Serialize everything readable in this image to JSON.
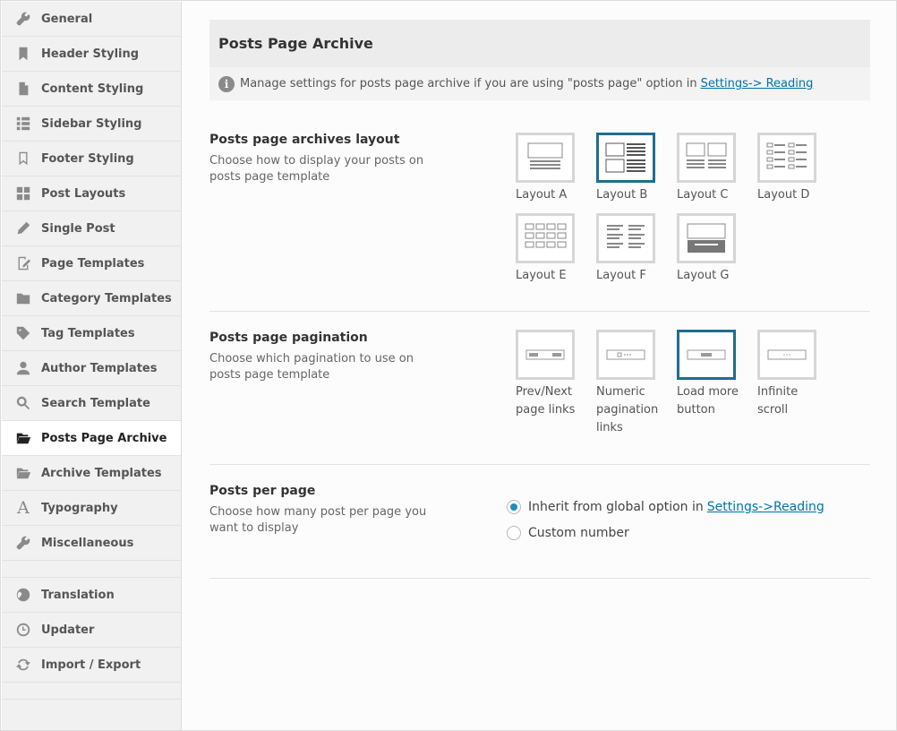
{
  "sidebar": {
    "items": [
      {
        "label": "General",
        "icon": "wrench-icon"
      },
      {
        "label": "Header Styling",
        "icon": "bookmark-icon"
      },
      {
        "label": "Content Styling",
        "icon": "document-icon"
      },
      {
        "label": "Sidebar Styling",
        "icon": "list-icon"
      },
      {
        "label": "Footer Styling",
        "icon": "bookmark-outline-icon"
      },
      {
        "label": "Post Layouts",
        "icon": "grid-icon"
      },
      {
        "label": "Single Post",
        "icon": "pencil-icon"
      },
      {
        "label": "Page Templates",
        "icon": "edit-page-icon"
      },
      {
        "label": "Category Templates",
        "icon": "folder-icon"
      },
      {
        "label": "Tag Templates",
        "icon": "tag-icon"
      },
      {
        "label": "Author Templates",
        "icon": "user-icon"
      },
      {
        "label": "Search Template",
        "icon": "search-icon"
      },
      {
        "label": "Posts Page Archive",
        "icon": "folder-open-icon",
        "active": true
      },
      {
        "label": "Archive Templates",
        "icon": "folder-open-icon"
      },
      {
        "label": "Typography",
        "icon": "typography-icon"
      },
      {
        "label": "Miscellaneous",
        "icon": "wrench-icon"
      }
    ],
    "bottom_items": [
      {
        "label": "Translation",
        "icon": "globe-icon"
      },
      {
        "label": "Updater",
        "icon": "clock-icon"
      },
      {
        "label": "Import / Export",
        "icon": "refresh-icon"
      }
    ]
  },
  "header": {
    "title": "Posts Page Archive",
    "notice_text": "Manage settings for posts page archive if you are using \"posts page\" option in",
    "notice_link": "Settings-> Reading"
  },
  "layout_section": {
    "title": "Posts page archives layout",
    "description": "Choose how to display your posts on posts page template",
    "options": [
      {
        "label": "Layout A"
      },
      {
        "label": "Layout B",
        "selected": true
      },
      {
        "label": "Layout C"
      },
      {
        "label": "Layout D"
      },
      {
        "label": "Layout E"
      },
      {
        "label": "Layout F"
      },
      {
        "label": "Layout G"
      }
    ]
  },
  "pagination_section": {
    "title": "Posts page pagination",
    "description": "Choose which pagination to use on posts page template",
    "options": [
      {
        "label": "Prev/Next page links"
      },
      {
        "label": "Numeric pagination links"
      },
      {
        "label": "Load more button",
        "selected": true
      },
      {
        "label": "Infinite scroll"
      }
    ]
  },
  "per_page_section": {
    "title": "Posts per page",
    "description": "Choose how many post per page you want to display",
    "option_inherit": "Inherit from global option in",
    "option_inherit_link": "Settings->Reading",
    "option_custom": "Custom number"
  },
  "colors": {
    "accent": "#1e6e8e",
    "link": "#0073aa",
    "radio_dot": "#1e8cbe"
  }
}
